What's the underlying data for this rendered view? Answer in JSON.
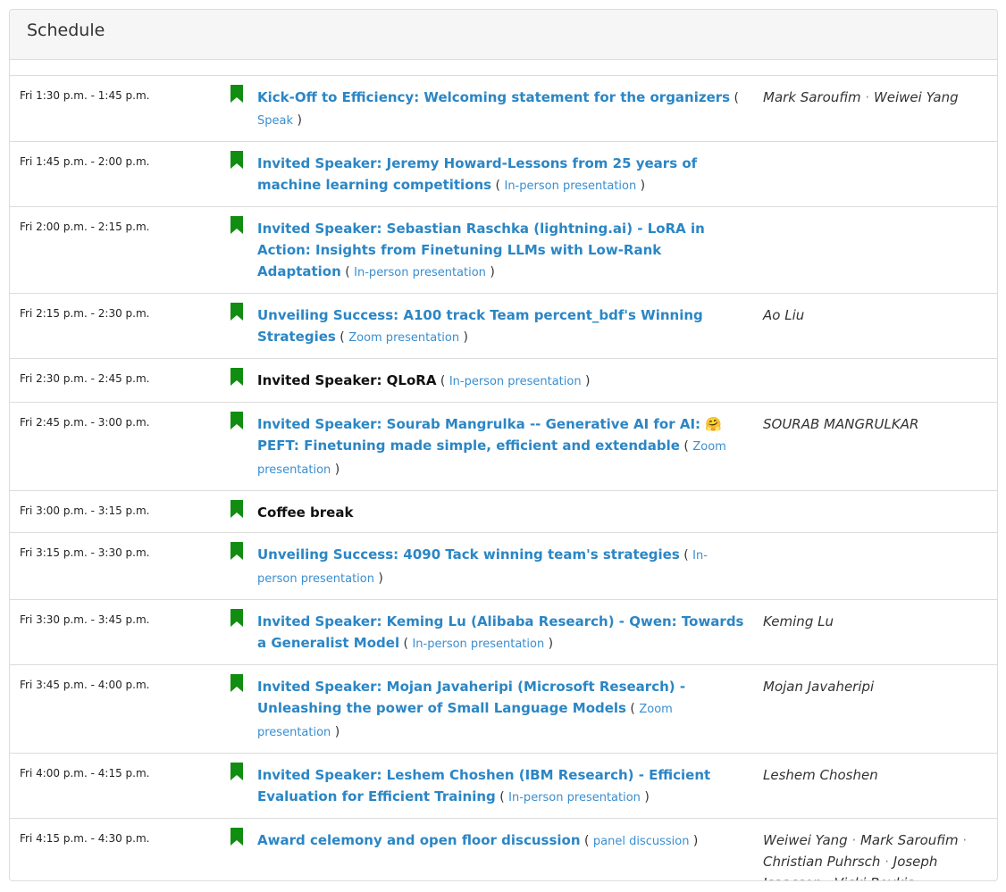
{
  "header": {
    "title": "Schedule"
  },
  "colors": {
    "link": "#2b86c5",
    "bookmark": "#118d11",
    "border": "#dcdcdc"
  },
  "icons": {
    "bookmark": "bookmark-icon"
  },
  "rows": [
    {
      "time": "Fri 1:30 p.m. - 1:45 p.m.",
      "title": "Kick-Off to Efficiency: Welcoming statement for the organizers",
      "type": "Speak",
      "speakers": [
        "Mark Saroufim",
        "Weiwei Yang"
      ],
      "linked": true
    },
    {
      "time": "Fri 1:45 p.m. - 2:00 p.m.",
      "title": "Invited Speaker: Jeremy Howard-Lessons from 25 years of machine learning competitions",
      "type": "In-person presentation",
      "speakers": [],
      "linked": true
    },
    {
      "time": "Fri 2:00 p.m. - 2:15 p.m.",
      "title": "Invited Speaker: Sebastian Raschka (lightning.ai) - LoRA in Action: Insights from Finetuning LLMs with Low-Rank Adaptation",
      "type": "In-person presentation",
      "speakers": [],
      "linked": true
    },
    {
      "time": "Fri 2:15 p.m. - 2:30 p.m.",
      "title": "Unveiling Success: A100 track Team percent_bdf's Winning Strategies",
      "type": "Zoom presentation",
      "speakers": [
        "Ao Liu"
      ],
      "linked": true
    },
    {
      "time": "Fri 2:30 p.m. - 2:45 p.m.",
      "title": "Invited Speaker: QLoRA",
      "type": "In-person presentation",
      "speakers": [],
      "linked": false
    },
    {
      "time": "Fri 2:45 p.m. - 3:00 p.m.",
      "title": "Invited Speaker: Sourab Mangrulka -- Generative AI for AI: 🤗 PEFT: Finetuning made simple, efficient and extendable",
      "type": "Zoom presentation",
      "speakers": [
        "SOURAB MANGRULKAR"
      ],
      "linked": true
    },
    {
      "time": "Fri 3:00 p.m. - 3:15 p.m.",
      "title": "Coffee break",
      "type": "",
      "speakers": [],
      "linked": false
    },
    {
      "time": "Fri 3:15 p.m. - 3:30 p.m.",
      "title": "Unveiling Success: 4090 Tack winning team's strategies",
      "type": "In-person presentation",
      "speakers": [],
      "linked": true
    },
    {
      "time": "Fri 3:30 p.m. - 3:45 p.m.",
      "title": "Invited Speaker: Keming Lu (Alibaba Research) - Qwen: Towards a Generalist Model",
      "type": "In-person presentation",
      "speakers": [
        "Keming Lu"
      ],
      "linked": true
    },
    {
      "time": "Fri 3:45 p.m. - 4:00 p.m.",
      "title": "Invited Speaker: Mojan Javaheripi (Microsoft Research) - Unleashing the power of Small Language Models",
      "type": "Zoom presentation",
      "speakers": [
        "Mojan Javaheripi"
      ],
      "linked": true
    },
    {
      "time": "Fri 4:00 p.m. - 4:15 p.m.",
      "title": "Invited Speaker: Leshem Choshen (IBM Research) - Efficient Evaluation for Efficient Training",
      "type": "In-person presentation",
      "speakers": [
        "Leshem Choshen"
      ],
      "linked": true
    },
    {
      "time": "Fri 4:15 p.m. - 4:30 p.m.",
      "title": "Award celemony and open floor discussion",
      "type": "panel discussion",
      "speakers": [
        "Weiwei Yang",
        "Mark Saroufim",
        "Christian Puhrsch",
        "Joseph Isaacson",
        "Vicki Boykis"
      ],
      "linked": true
    }
  ]
}
